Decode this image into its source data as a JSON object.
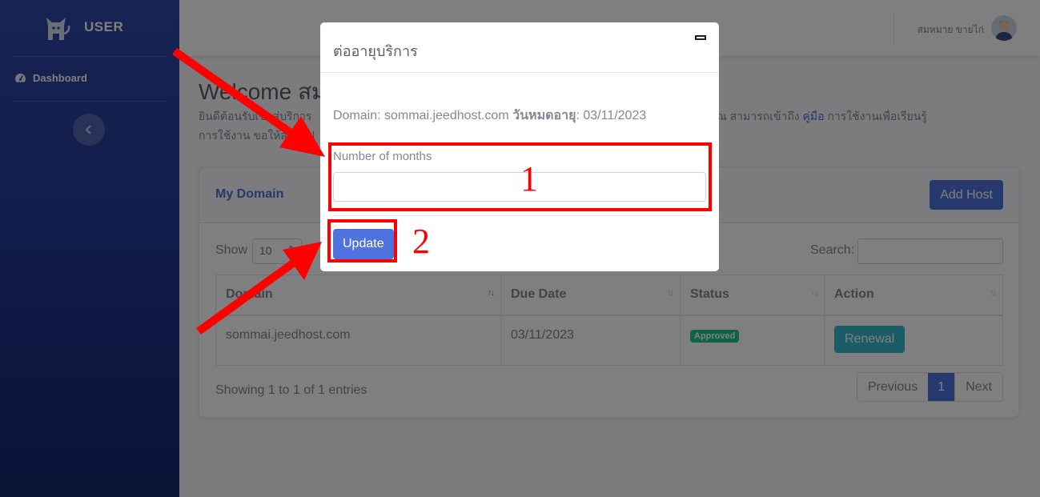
{
  "sidebar": {
    "brand": "USER",
    "brand_icon": "cat-icon",
    "items": [
      {
        "label": "Dashboard",
        "icon": "tachometer-icon"
      }
    ],
    "toggle_icon": "chevron-left-icon"
  },
  "topbar": {
    "username": "สมหมาย ขายไก่",
    "avatar_icon": "user-avatar-icon"
  },
  "page": {
    "welcome": "Welcome สม",
    "intro_line1_start": "ยินดีต้อนรับเข้าสู่บริการ",
    "intro_line1_end": "ารเว็บไซต์ของคุณ สามารถเข้าถึง",
    "intro_link": "คู่มือ",
    "intro_line1_tail": "การใช้งานเพื่อเรียนรู้",
    "intro_line2": "การใช้งาน ขอให้สนุกไป"
  },
  "card": {
    "title": "My Domain",
    "add_button": "Add Host",
    "show_label": "Show",
    "show_value": "10",
    "search_label": "Search:",
    "columns": [
      "Domain",
      "Due Date",
      "Status",
      "Action"
    ],
    "rows": [
      {
        "domain": "sommai.jeedhost.com",
        "due_date": "03/11/2023",
        "status": "Approved",
        "action": "Renewal"
      }
    ],
    "showing": "Showing 1 to 1 of 1 entries",
    "pager": {
      "previous": "Previous",
      "current": "1",
      "next": "Next"
    }
  },
  "modal": {
    "title": "ต่ออายุบริการ",
    "domain_prefix": "Domain: sommai.jeedhost.com",
    "expiry_label": "วันหมดอายุ",
    "expiry_value": ": 03/11/2023",
    "months_label": "Number of months",
    "months_value": "",
    "update_button": "Update"
  },
  "annotations": {
    "step1": "1",
    "step2": "2",
    "color": "#ff0000"
  },
  "colors": {
    "primary": "#4e73df",
    "success": "#1cc88a",
    "info": "#36b9cc"
  }
}
